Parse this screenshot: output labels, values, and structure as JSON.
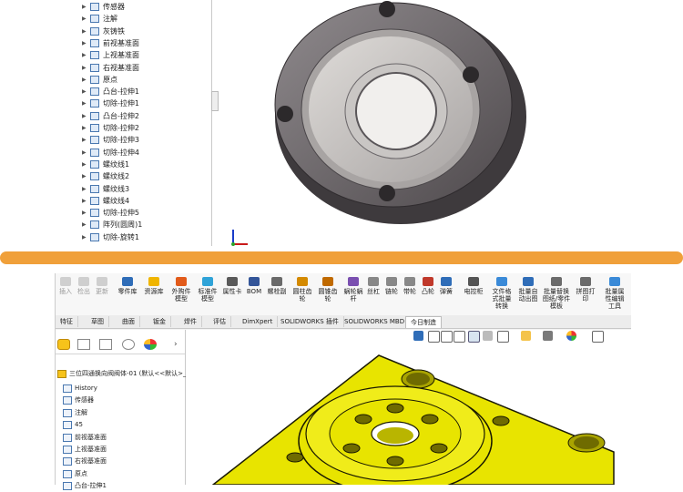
{
  "top_tree": {
    "items": [
      {
        "label": "传感器",
        "icon": "sensor-icon"
      },
      {
        "label": "注解",
        "icon": "annotation-icon"
      },
      {
        "label": "灰铸铁",
        "icon": "material-icon"
      },
      {
        "label": "前视基准面",
        "icon": "plane-icon"
      },
      {
        "label": "上视基准面",
        "icon": "plane-icon"
      },
      {
        "label": "右视基准面",
        "icon": "plane-icon"
      },
      {
        "label": "原点",
        "icon": "origin-icon"
      },
      {
        "label": "凸台-拉伸1",
        "icon": "boss-extrude-icon"
      },
      {
        "label": "切除-拉伸1",
        "icon": "cut-extrude-icon"
      },
      {
        "label": "凸台-拉伸2",
        "icon": "boss-extrude-icon"
      },
      {
        "label": "切除-拉伸2",
        "icon": "cut-extrude-icon"
      },
      {
        "label": "切除-拉伸3",
        "icon": "cut-extrude-icon"
      },
      {
        "label": "切除-拉伸4",
        "icon": "cut-extrude-icon"
      },
      {
        "label": "螺纹线1",
        "icon": "thread-icon"
      },
      {
        "label": "螺纹线2",
        "icon": "thread-icon"
      },
      {
        "label": "螺纹线3",
        "icon": "thread-icon"
      },
      {
        "label": "螺纹线4",
        "icon": "thread-icon"
      },
      {
        "label": "切除-拉伸5",
        "icon": "cut-extrude-icon"
      },
      {
        "label": "阵列(圆周)1",
        "icon": "circular-pattern-icon"
      },
      {
        "label": "切除-旋转1",
        "icon": "cut-revolve-icon"
      }
    ]
  },
  "ribbon": {
    "buttons": [
      {
        "label": "插入",
        "disabled": true
      },
      {
        "label": "检出",
        "disabled": true
      },
      {
        "label": "更新",
        "disabled": true
      },
      {
        "label": "零件库",
        "disabled": false
      },
      {
        "label": "资源库",
        "disabled": false
      },
      {
        "label": "外购件\n模型",
        "disabled": false
      },
      {
        "label": "标准件\n模型",
        "disabled": false
      },
      {
        "label": "属性卡",
        "disabled": false
      },
      {
        "label": "BOM",
        "disabled": false
      },
      {
        "label": "螺栓副",
        "disabled": false
      },
      {
        "label": "圆柱齿\n轮",
        "disabled": false
      },
      {
        "label": "圆锥齿\n轮",
        "disabled": false
      },
      {
        "label": "蜗轮蜗\n杆",
        "disabled": false
      },
      {
        "label": "丝杠",
        "disabled": false
      },
      {
        "label": "链轮",
        "disabled": false
      },
      {
        "label": "带轮",
        "disabled": false
      },
      {
        "label": "凸轮",
        "disabled": false
      },
      {
        "label": "弹簧",
        "disabled": false
      },
      {
        "label": "电控柜",
        "disabled": false
      },
      {
        "label": "文件格\n式批量\n转换",
        "disabled": false
      },
      {
        "label": "批量自\n动出图",
        "disabled": false
      },
      {
        "label": "批量替换\n图纸/零件\n模板",
        "disabled": false
      },
      {
        "label": "拼图打\n印",
        "disabled": false
      },
      {
        "label": "批量属\n性编辑\n工具",
        "disabled": false
      }
    ]
  },
  "tabs": [
    {
      "label": "特征",
      "active": false
    },
    {
      "label": "草图",
      "active": false
    },
    {
      "label": "曲面",
      "active": false
    },
    {
      "label": "钣金",
      "active": false
    },
    {
      "label": "焊件",
      "active": false
    },
    {
      "label": "评估",
      "active": false
    },
    {
      "label": "DimXpert",
      "active": false
    },
    {
      "label": "SOLIDWORKS 插件",
      "active": false
    },
    {
      "label": "SOLIDWORKS MBD",
      "active": false
    },
    {
      "label": "今日制造",
      "active": true
    }
  ],
  "feature_tree": {
    "root": "三位四通换向阀阀体-01 (默认<<默认>_",
    "items": [
      {
        "label": "History",
        "icon": "history-icon"
      },
      {
        "label": "传感器",
        "icon": "sensor-icon"
      },
      {
        "label": "注解",
        "icon": "annotation-icon"
      },
      {
        "label": "45",
        "icon": "material-icon"
      },
      {
        "label": "前视基准面",
        "icon": "plane-icon"
      },
      {
        "label": "上视基准面",
        "icon": "plane-icon"
      },
      {
        "label": "右视基准面",
        "icon": "plane-icon"
      },
      {
        "label": "原点",
        "icon": "origin-icon"
      },
      {
        "label": "凸台-拉伸1",
        "icon": "boss-extrude-icon"
      }
    ]
  },
  "colors": {
    "orange_band": "#f0a03a",
    "part_gray": "#6f6a6e",
    "part_yellow": "#e8e400"
  }
}
